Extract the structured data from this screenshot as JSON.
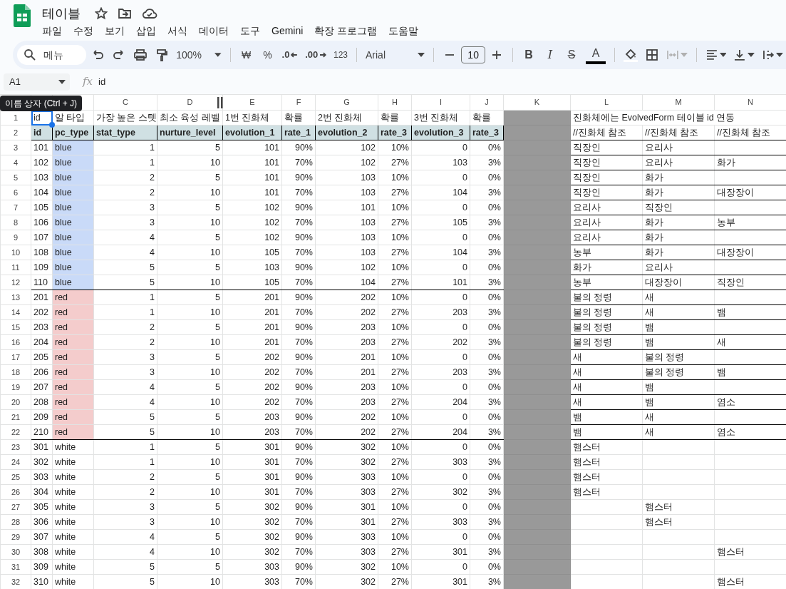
{
  "document": {
    "title": "테이블"
  },
  "menu": [
    "파일",
    "수정",
    "보기",
    "삽입",
    "서식",
    "데이터",
    "도구",
    "Gemini",
    "확장 프로그램",
    "도움말"
  ],
  "toolbar": {
    "search_placeholder": "메뉴",
    "zoom": "100%",
    "number_formats": [
      {
        "kind": "currency",
        "label": "₩"
      },
      {
        "kind": "percent",
        "label": "%"
      },
      {
        "kind": "decrease",
        "label": ".0"
      },
      {
        "kind": "increase",
        "label": ".00"
      },
      {
        "kind": "plain",
        "label": "123"
      }
    ],
    "font": "Arial",
    "font_size": "10",
    "text_styles": [
      {
        "kind": "bold",
        "label": "B"
      },
      {
        "kind": "italic",
        "label": "I"
      },
      {
        "kind": "strike",
        "label": "S"
      },
      {
        "kind": "color",
        "label": "A"
      }
    ],
    "merge_disabled": true
  },
  "formula_bar": {
    "name_box": "A1",
    "function_label": "fx",
    "formula": "id"
  },
  "tooltip": "이름 상자 (Ctrl + J)",
  "grid": {
    "columns": [
      "C",
      "D",
      "E",
      "F",
      "G",
      "H",
      "I",
      "J",
      "K",
      "L",
      "M",
      "N"
    ],
    "head_rows": [
      {
        "n": "1",
        "kind": "note",
        "selected": true,
        "c": [
          "id",
          "알 타입",
          "가장 높은 스텟",
          "최소 육성 레벨",
          "1번 진화체",
          "확률",
          "2번 진화체",
          "확률",
          "3번 진화체",
          "확률"
        ],
        "note": "진화체에는 EvolvedForm 테이블 id 연동"
      },
      {
        "n": "2",
        "kind": "header",
        "selected": false,
        "color": "#d0e0e3",
        "c": [
          "id",
          "pc_type",
          "stat_type",
          "nurture_level",
          "evolution_1",
          "rate_1",
          "evolution_2",
          "rate_3",
          "evolution_3",
          "rate_3"
        ],
        "refs": {
          "L": "//진화체 참조",
          "M": "//진화체 참조",
          "N": "//진화체 참조"
        }
      }
    ],
    "groups": [
      {
        "color": "#c9daf8",
        "ref_border": true,
        "rows": [
          {
            "n": "3",
            "selected": false,
            "c": [
              "101",
              "blue",
              "1",
              "5",
              "101",
              "90%",
              "102",
              "10%",
              "0",
              "0%"
            ],
            "refs": {
              "L": "직장인",
              "M": "요리사"
            }
          },
          {
            "n": "4",
            "selected": false,
            "c": [
              "102",
              "blue",
              "1",
              "10",
              "101",
              "70%",
              "102",
              "27%",
              "103",
              "3%"
            ],
            "refs": {
              "L": "직장인",
              "M": "요리사",
              "N": "화가"
            }
          },
          {
            "n": "5",
            "selected": false,
            "c": [
              "103",
              "blue",
              "2",
              "5",
              "101",
              "90%",
              "103",
              "10%",
              "0",
              "0%"
            ],
            "refs": {
              "L": "직장인",
              "M": "화가"
            }
          },
          {
            "n": "6",
            "selected": false,
            "c": [
              "104",
              "blue",
              "2",
              "10",
              "101",
              "70%",
              "103",
              "27%",
              "104",
              "3%"
            ],
            "refs": {
              "L": "직장인",
              "M": "화가",
              "N": "대장장이"
            }
          },
          {
            "n": "7",
            "selected": false,
            "c": [
              "105",
              "blue",
              "3",
              "5",
              "102",
              "90%",
              "101",
              "10%",
              "0",
              "0%"
            ],
            "refs": {
              "L": "요리사",
              "M": "직장인"
            }
          },
          {
            "n": "8",
            "selected": false,
            "c": [
              "106",
              "blue",
              "3",
              "10",
              "102",
              "70%",
              "103",
              "27%",
              "105",
              "3%"
            ],
            "refs": {
              "L": "요리사",
              "M": "화가",
              "N": "농부"
            }
          },
          {
            "n": "9",
            "selected": false,
            "c": [
              "107",
              "blue",
              "4",
              "5",
              "102",
              "90%",
              "103",
              "10%",
              "0",
              "0%"
            ],
            "refs": {
              "L": "요리사",
              "M": "화가"
            }
          },
          {
            "n": "10",
            "selected": false,
            "c": [
              "108",
              "blue",
              "4",
              "10",
              "105",
              "70%",
              "103",
              "27%",
              "104",
              "3%"
            ],
            "refs": {
              "L": "농부",
              "M": "화가",
              "N": "대장장이"
            }
          },
          {
            "n": "11",
            "selected": false,
            "c": [
              "109",
              "blue",
              "5",
              "5",
              "103",
              "90%",
              "102",
              "10%",
              "0",
              "0%"
            ],
            "refs": {
              "L": "화가",
              "M": "요리사"
            }
          },
          {
            "n": "12",
            "selected": false,
            "c": [
              "110",
              "blue",
              "5",
              "10",
              "105",
              "70%",
              "104",
              "27%",
              "101",
              "3%"
            ],
            "refs": {
              "L": "농부",
              "M": "대장장이",
              "N": "직장인"
            }
          }
        ]
      },
      {
        "color": "#f4cccc",
        "ref_border": true,
        "rows": [
          {
            "n": "13",
            "selected": false,
            "c": [
              "201",
              "red",
              "1",
              "5",
              "201",
              "90%",
              "202",
              "10%",
              "0",
              "0%"
            ],
            "refs": {
              "L": "불의 정령",
              "M": "새"
            }
          },
          {
            "n": "14",
            "selected": false,
            "c": [
              "202",
              "red",
              "1",
              "10",
              "201",
              "70%",
              "202",
              "27%",
              "203",
              "3%"
            ],
            "refs": {
              "L": "불의 정령",
              "M": "새",
              "N": "뱀"
            }
          },
          {
            "n": "15",
            "selected": false,
            "c": [
              "203",
              "red",
              "2",
              "5",
              "201",
              "90%",
              "203",
              "10%",
              "0",
              "0%"
            ],
            "refs": {
              "L": "불의 정령",
              "M": "뱀"
            }
          },
          {
            "n": "16",
            "selected": false,
            "c": [
              "204",
              "red",
              "2",
              "10",
              "201",
              "70%",
              "203",
              "27%",
              "202",
              "3%"
            ],
            "refs": {
              "L": "불의 정령",
              "M": "뱀",
              "N": "새"
            }
          },
          {
            "n": "17",
            "selected": false,
            "c": [
              "205",
              "red",
              "3",
              "5",
              "202",
              "90%",
              "201",
              "10%",
              "0",
              "0%"
            ],
            "refs": {
              "L": "새",
              "M": "불의 정령"
            }
          },
          {
            "n": "18",
            "selected": false,
            "c": [
              "206",
              "red",
              "3",
              "10",
              "202",
              "70%",
              "201",
              "27%",
              "203",
              "3%"
            ],
            "refs": {
              "L": "새",
              "M": "불의 정령",
              "N": "뱀"
            }
          },
          {
            "n": "19",
            "selected": false,
            "c": [
              "207",
              "red",
              "4",
              "5",
              "202",
              "90%",
              "203",
              "10%",
              "0",
              "0%"
            ],
            "refs": {
              "L": "새",
              "M": "뱀"
            }
          },
          {
            "n": "20",
            "selected": false,
            "c": [
              "208",
              "red",
              "4",
              "10",
              "202",
              "70%",
              "203",
              "27%",
              "204",
              "3%"
            ],
            "refs": {
              "L": "새",
              "M": "뱀",
              "N": "염소"
            }
          },
          {
            "n": "21",
            "selected": false,
            "c": [
              "209",
              "red",
              "5",
              "5",
              "203",
              "90%",
              "202",
              "10%",
              "0",
              "0%"
            ],
            "refs": {
              "L": "뱀",
              "M": "새"
            }
          },
          {
            "n": "22",
            "selected": false,
            "c": [
              "210",
              "red",
              "5",
              "10",
              "203",
              "70%",
              "202",
              "27%",
              "204",
              "3%"
            ],
            "refs": {
              "L": "뱀",
              "M": "새",
              "N": "염소"
            }
          }
        ]
      },
      {
        "color": "#ffffff",
        "ref_border": false,
        "rows": [
          {
            "n": "23",
            "selected": false,
            "c": [
              "301",
              "white",
              "1",
              "5",
              "301",
              "90%",
              "302",
              "10%",
              "0",
              "0%"
            ],
            "refs": {
              "L": "햄스터"
            }
          },
          {
            "n": "24",
            "selected": false,
            "c": [
              "302",
              "white",
              "1",
              "10",
              "301",
              "70%",
              "302",
              "27%",
              "303",
              "3%"
            ],
            "refs": {
              "L": "햄스터"
            }
          },
          {
            "n": "25",
            "selected": false,
            "c": [
              "303",
              "white",
              "2",
              "5",
              "301",
              "90%",
              "303",
              "10%",
              "0",
              "0%"
            ],
            "refs": {
              "L": "햄스터"
            }
          },
          {
            "n": "26",
            "selected": false,
            "c": [
              "304",
              "white",
              "2",
              "10",
              "301",
              "70%",
              "303",
              "27%",
              "302",
              "3%"
            ],
            "refs": {
              "L": "햄스터"
            }
          },
          {
            "n": "27",
            "selected": false,
            "c": [
              "305",
              "white",
              "3",
              "5",
              "302",
              "90%",
              "301",
              "10%",
              "0",
              "0%"
            ],
            "refs": {
              "M": "햄스터"
            }
          },
          {
            "n": "28",
            "selected": false,
            "c": [
              "306",
              "white",
              "3",
              "10",
              "302",
              "70%",
              "301",
              "27%",
              "303",
              "3%"
            ],
            "refs": {
              "M": "햄스터"
            }
          },
          {
            "n": "29",
            "selected": false,
            "c": [
              "307",
              "white",
              "4",
              "5",
              "302",
              "90%",
              "303",
              "10%",
              "0",
              "0%"
            ]
          },
          {
            "n": "30",
            "selected": false,
            "c": [
              "308",
              "white",
              "4",
              "10",
              "302",
              "70%",
              "303",
              "27%",
              "301",
              "3%"
            ],
            "refs": {
              "N": "햄스터"
            }
          },
          {
            "n": "31",
            "selected": false,
            "c": [
              "309",
              "white",
              "5",
              "5",
              "303",
              "90%",
              "302",
              "10%",
              "0",
              "0%"
            ]
          },
          {
            "n": "32",
            "selected": false,
            "c": [
              "310",
              "white",
              "5",
              "10",
              "303",
              "70%",
              "302",
              "27%",
              "301",
              "3%"
            ],
            "refs": {
              "N": "햄스터"
            }
          }
        ]
      }
    ]
  }
}
